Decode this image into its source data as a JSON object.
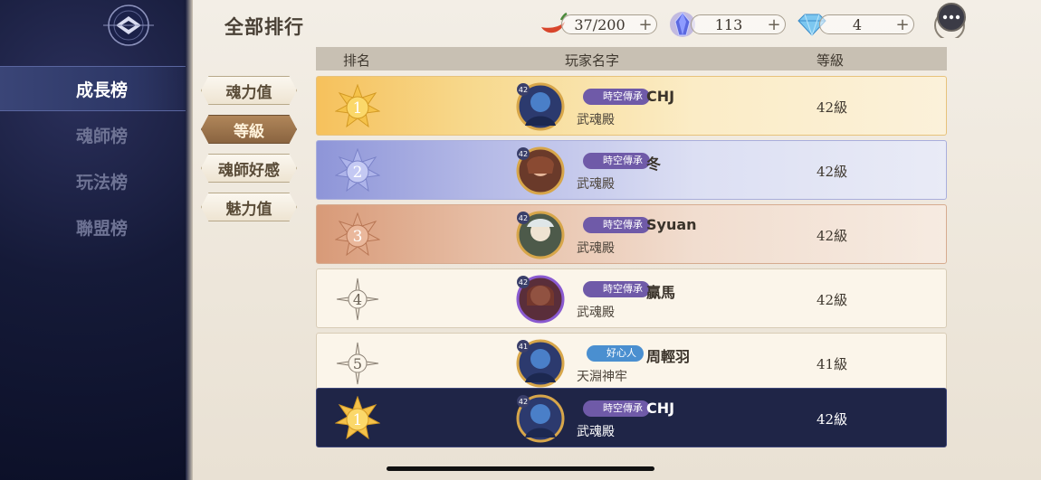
{
  "page_title": "全部排行",
  "resources": {
    "stamina": {
      "value": "37/200",
      "plus": "+",
      "icon": "chili-pepper-icon"
    },
    "soul_crystal": {
      "value": "113",
      "plus": "+",
      "icon": "purple-crystal-icon"
    },
    "diamond": {
      "value": "4",
      "plus": "+",
      "icon": "diamond-icon"
    }
  },
  "sidebar": {
    "items": [
      {
        "label": "成長榜",
        "active": true
      },
      {
        "label": "魂師榜",
        "active": false
      },
      {
        "label": "玩法榜",
        "active": false
      },
      {
        "label": "聯盟榜",
        "active": false
      }
    ]
  },
  "filters": [
    {
      "label": "魂力值",
      "active": false
    },
    {
      "label": "等級",
      "active": true
    },
    {
      "label": "魂師好感",
      "active": false
    },
    {
      "label": "魅力值",
      "active": false
    }
  ],
  "table": {
    "headers": {
      "rank": "排名",
      "name": "玩家名字",
      "level": "等級"
    },
    "rows": [
      {
        "rank": "1",
        "avatar_level": "42",
        "title": "時空傳承",
        "name": "CHJ",
        "guild": "武魂殿",
        "level": "42級"
      },
      {
        "rank": "2",
        "avatar_level": "42",
        "title": "時空傳承",
        "name": "冬",
        "guild": "武魂殿",
        "level": "42級"
      },
      {
        "rank": "3",
        "avatar_level": "42",
        "title": "時空傳承",
        "name": "Syuan",
        "guild": "武魂殿",
        "level": "42級"
      },
      {
        "rank": "4",
        "avatar_level": "42",
        "title": "時空傳承",
        "name": "贏馬",
        "guild": "武魂殿",
        "level": "42級"
      },
      {
        "rank": "5",
        "avatar_level": "41",
        "title": "好心人",
        "name": "周輕羽",
        "guild": "天淵神牢",
        "level": "41級"
      }
    ],
    "self_row": {
      "rank": "1",
      "avatar_level": "42",
      "title": "時空傳承",
      "name": "CHJ",
      "guild": "武魂殿",
      "level": "42級"
    }
  },
  "colors": {
    "gold": "#f5c24a",
    "silver_blue": "#8e95d8",
    "bronze": "#d89a78",
    "title_purple": "#6f5aa8",
    "title_blue": "#4a8fd0",
    "self_row_bg": "#1f2547"
  }
}
